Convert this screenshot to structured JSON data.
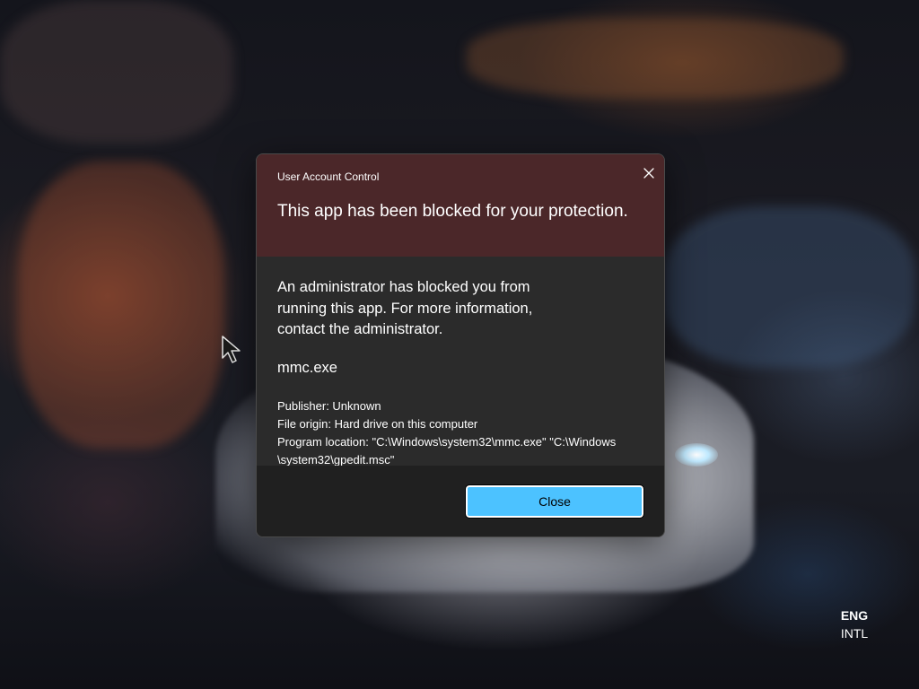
{
  "dialog": {
    "title": "User Account Control",
    "headline": "This app has been blocked for your protection.",
    "message": "An administrator has blocked you from running this app. For more information, contact the administrator.",
    "app_name": "mmc.exe",
    "publisher": "Publisher: Unknown",
    "file_origin": "File origin: Hard drive on this computer",
    "program_location_line1": "Program location: \"C:\\Windows\\system32\\mmc.exe\" \"C:\\Windows",
    "program_location_line2": "\\system32\\gpedit.msc\"",
    "close_button_label": "Close",
    "close_icon": "close-icon",
    "header_color": "#4b2729",
    "button_color": "#4cc2ff"
  },
  "taskbar": {
    "language_code": "ENG",
    "keyboard_layout": "INTL"
  },
  "icons": {
    "cursor": "mouse-pointer-icon"
  }
}
